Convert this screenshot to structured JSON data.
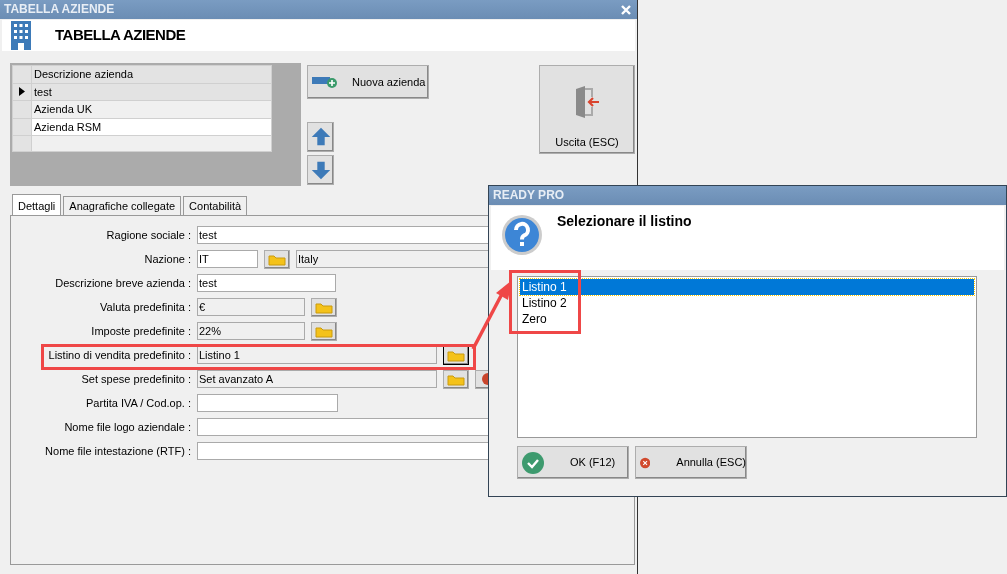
{
  "window": {
    "title": "TABELLA AZIENDE"
  },
  "header": {
    "title": "TABELLA AZIENDE"
  },
  "company_table": {
    "columns": [
      "Descrizione azienda"
    ],
    "rows": [
      {
        "cells": [
          "test"
        ],
        "selected": true
      },
      {
        "cells": [
          "Azienda UK"
        ],
        "selected": false
      },
      {
        "cells": [
          "Azienda RSM"
        ],
        "selected": false
      },
      {
        "cells": [],
        "selected": false
      }
    ]
  },
  "new_button": {
    "label": "Nuova azienda"
  },
  "exit_button": {
    "label": "Uscita (ESC)"
  },
  "tabs": [
    {
      "label": "Dettagli",
      "selected": true
    },
    {
      "label": "Anagrafiche collegate",
      "selected": false
    },
    {
      "label": "Contabilità",
      "selected": false
    }
  ],
  "form": [
    {
      "label": "Ragione sociale :",
      "fields": [
        {
          "kind": "input",
          "value": "test",
          "readonly": false
        }
      ]
    },
    {
      "label": "Nazione :",
      "fields": [
        {
          "kind": "input",
          "value": "IT",
          "readonly": false
        },
        {
          "kind": "lookup",
          "focused": false
        },
        {
          "kind": "input",
          "value": "Italy",
          "readonly": true
        }
      ]
    },
    {
      "label": "Descrizione breve azienda :",
      "fields": [
        {
          "kind": "input",
          "value": "test",
          "readonly": false
        }
      ]
    },
    {
      "label": "Valuta predefinita :",
      "fields": [
        {
          "kind": "input",
          "value": "€",
          "readonly": true
        },
        {
          "kind": "lookup",
          "focused": false
        }
      ]
    },
    {
      "label": "Imposte predefinite :",
      "fields": [
        {
          "kind": "input",
          "value": "22%",
          "readonly": true
        },
        {
          "kind": "lookup",
          "focused": false
        }
      ]
    },
    {
      "label": "Listino di vendita predefinito :",
      "fields": [
        {
          "kind": "input",
          "value": "Listino 1",
          "readonly": true
        },
        {
          "kind": "lookup",
          "focused": true
        }
      ]
    },
    {
      "label": "Set spese predefinito :",
      "fields": [
        {
          "kind": "input",
          "value": "Set avanzato A",
          "readonly": true
        },
        {
          "kind": "lookup",
          "focused": false
        },
        {
          "kind": "clear"
        }
      ]
    },
    {
      "label": "Partita IVA / Cod.op. :",
      "fields": [
        {
          "kind": "input",
          "readonly": false
        }
      ]
    },
    {
      "label": "Nome file logo aziendale :",
      "fields": [
        {
          "kind": "input",
          "readonly": false
        }
      ]
    },
    {
      "label": "Nome file intestazione (RTF) :",
      "fields": [
        {
          "kind": "input",
          "readonly": false
        }
      ]
    }
  ],
  "dialog": {
    "title": "READY PRO",
    "message": "Selezionare il listino",
    "options": [
      {
        "label": "Listino 1",
        "selected": true
      },
      {
        "label": "Listino 2",
        "selected": false
      },
      {
        "label": "Zero",
        "selected": false
      }
    ],
    "buttons": [
      {
        "label": "OK (F12)",
        "kind": "ok"
      },
      {
        "label": "Annulla (ESC)",
        "kind": "cancel"
      }
    ]
  }
}
